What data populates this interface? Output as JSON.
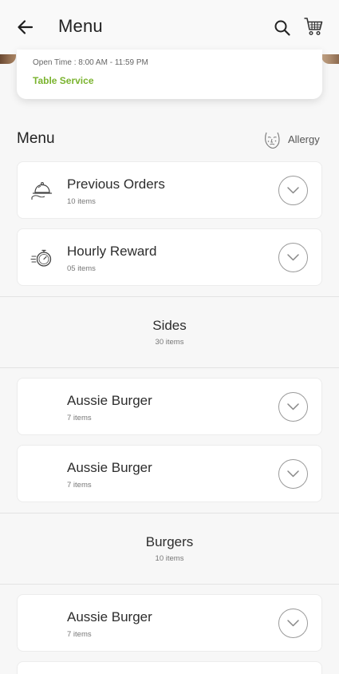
{
  "header": {
    "title": "Menu",
    "back_icon": "arrow-left-icon",
    "search_icon": "search-icon",
    "cart_icon": "cart-icon"
  },
  "restaurant": {
    "open_time": "Open Time : 8:00 AM - 11:59 PM",
    "service": "Table Service",
    "service_color": "#7ab32e"
  },
  "menu_section": {
    "title": "Menu",
    "allergy_label": "Allergy",
    "allergy_icon": "allergy-face-icon"
  },
  "cards": [
    {
      "title": "Previous Orders",
      "count": "10 items",
      "icon": "cloche-icon"
    },
    {
      "title": "Hourly Reward",
      "count": "05 items",
      "icon": "stopwatch-icon"
    },
    {
      "title": "Aussie Burger",
      "count": "7 items"
    },
    {
      "title": "Aussie Burger",
      "count": "7 items"
    },
    {
      "title": "Aussie Burger",
      "count": "7 items"
    }
  ],
  "categories": [
    {
      "title": "Sides",
      "count": "30 items"
    },
    {
      "title": "Burgers",
      "count": "10 items"
    }
  ]
}
